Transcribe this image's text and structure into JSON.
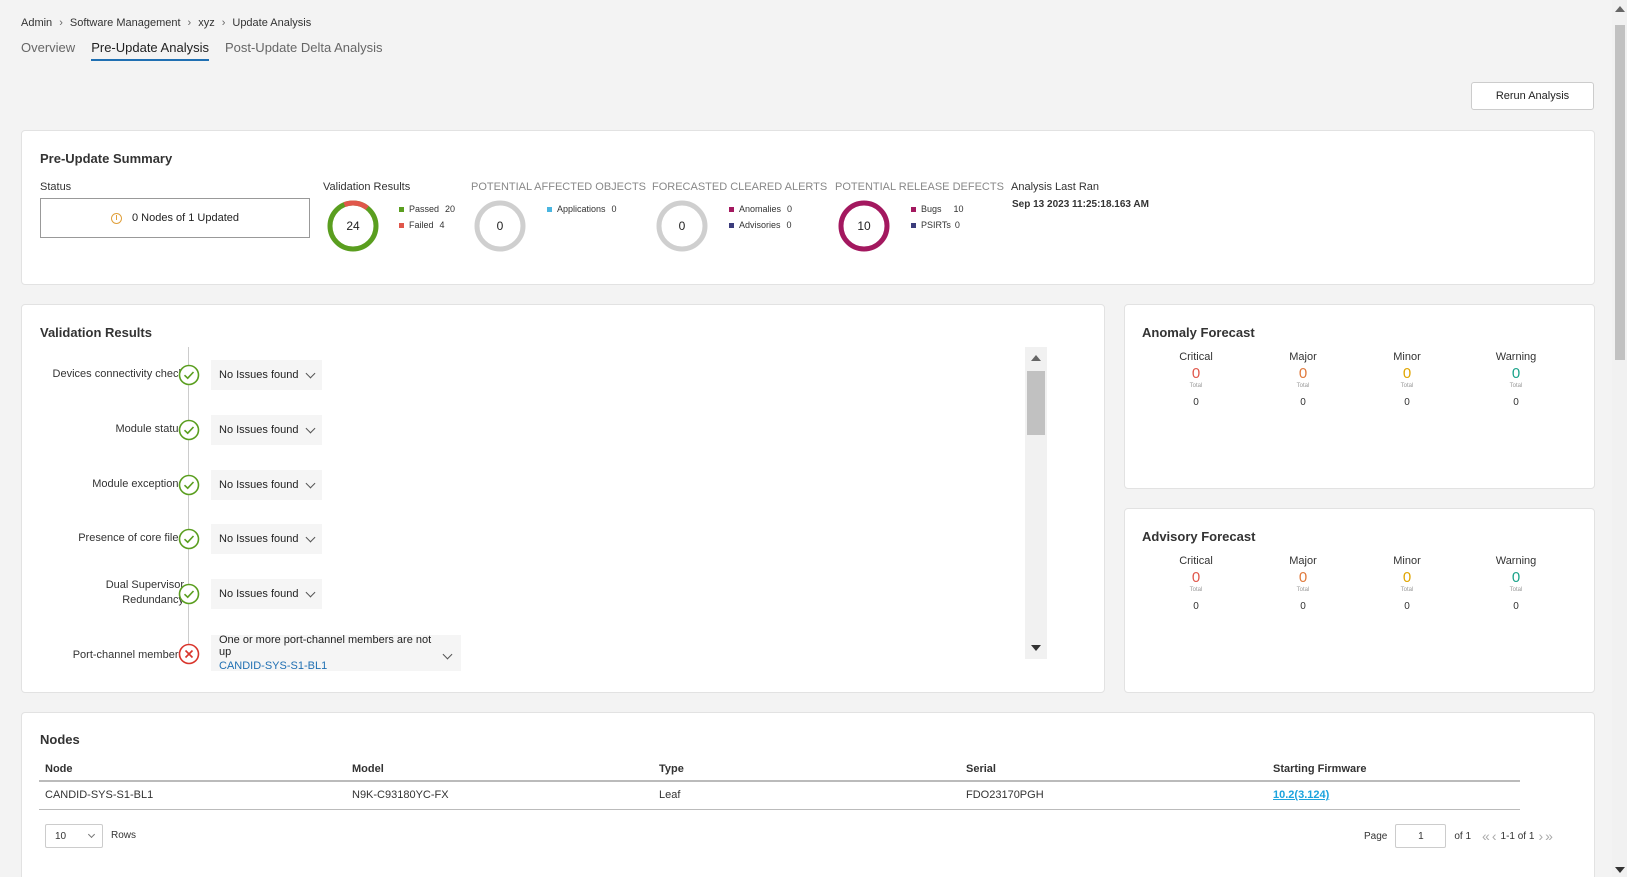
{
  "breadcrumb": [
    "Admin",
    "Software Management",
    "xyz",
    "Update Analysis"
  ],
  "tabs": [
    {
      "label": "Overview",
      "active": false
    },
    {
      "label": "Pre-Update Analysis",
      "active": true
    },
    {
      "label": "Post-Update Delta Analysis",
      "active": false
    }
  ],
  "rerun_label": "Rerun Analysis",
  "summary": {
    "title": "Pre-Update Summary",
    "status_label": "Status",
    "status_value": "0 Nodes of 1 Updated",
    "validation": {
      "label": "Validation Results",
      "total": "24",
      "passed_label": "Passed",
      "passed": 20,
      "failed_label": "Failed",
      "failed": 4,
      "passed_color": "#5a9e1f",
      "failed_color": "#e0574b"
    },
    "affected": {
      "label": "POTENTIAL AFFECTED OBJECTS",
      "total": "0",
      "items": [
        {
          "label": "Applications",
          "value": "0",
          "color": "#49b5e0"
        }
      ]
    },
    "cleared": {
      "label": "FORECASTED CLEARED ALERTS",
      "total": "0",
      "items": [
        {
          "label": "Anomalies",
          "value": "0",
          "color": "#a3185f"
        },
        {
          "label": "Advisories",
          "value": "0",
          "color": "#3b3c7c"
        }
      ]
    },
    "defects": {
      "label": "POTENTIAL RELEASE DEFECTS",
      "total": "10",
      "color": "#a3185f",
      "items": [
        {
          "label": "Bugs",
          "value": "10",
          "color": "#a3185f"
        },
        {
          "label": "PSIRTs",
          "value": "0",
          "color": "#3b3c7c"
        }
      ]
    },
    "last_ran_label": "Analysis Last Ran",
    "last_ran_value": "Sep 13 2023 11:25:18.163 AM"
  },
  "validation_results": {
    "title": "Validation Results",
    "rows": [
      {
        "label": "Devices connectivity check",
        "status": "pass",
        "result": "No Issues found"
      },
      {
        "label": "Module status",
        "status": "pass",
        "result": "No Issues found"
      },
      {
        "label": "Module exceptions",
        "status": "pass",
        "result": "No Issues found"
      },
      {
        "label": "Presence of core files",
        "status": "pass",
        "result": "No Issues found"
      },
      {
        "label": "Dual Supervisor Redundancy",
        "status": "pass",
        "result": "No Issues found"
      },
      {
        "label": "Port-channel members",
        "status": "fail",
        "result": "One or more port-channel members are not up",
        "link": "CANDID-SYS-S1-BL1"
      }
    ]
  },
  "anomaly_forecast": {
    "title": "Anomaly Forecast",
    "columns": [
      {
        "label": "Critical",
        "value": "0",
        "total_label": "Total",
        "sub": "0",
        "color": "#e0574b"
      },
      {
        "label": "Major",
        "value": "0",
        "total_label": "Total",
        "sub": "0",
        "color": "#e07a3c"
      },
      {
        "label": "Minor",
        "value": "0",
        "total_label": "Total",
        "sub": "0",
        "color": "#e0a500"
      },
      {
        "label": "Warning",
        "value": "0",
        "total_label": "Total",
        "sub": "0",
        "color": "#1ba38a"
      }
    ]
  },
  "advisory_forecast": {
    "title": "Advisory Forecast",
    "columns": [
      {
        "label": "Critical",
        "value": "0",
        "total_label": "Total",
        "sub": "0",
        "color": "#e0574b"
      },
      {
        "label": "Major",
        "value": "0",
        "total_label": "Total",
        "sub": "0",
        "color": "#e07a3c"
      },
      {
        "label": "Minor",
        "value": "0",
        "total_label": "Total",
        "sub": "0",
        "color": "#e0a500"
      },
      {
        "label": "Warning",
        "value": "0",
        "total_label": "Total",
        "sub": "0",
        "color": "#1ba38a"
      }
    ]
  },
  "nodes": {
    "title": "Nodes",
    "headers": [
      "Node",
      "Model",
      "Type",
      "Serial",
      "Starting Firmware"
    ],
    "rows": [
      {
        "node": "CANDID-SYS-S1-BL1",
        "model": "N9K-C93180YC-FX",
        "type": "Leaf",
        "serial": "FDO23170PGH",
        "firmware": "10.2(3.124)"
      }
    ],
    "rows_value": "10",
    "rows_label": "Rows",
    "page_label": "Page",
    "page_value": "1",
    "of_label": "of 1",
    "range_label": "1-1 of 1"
  }
}
